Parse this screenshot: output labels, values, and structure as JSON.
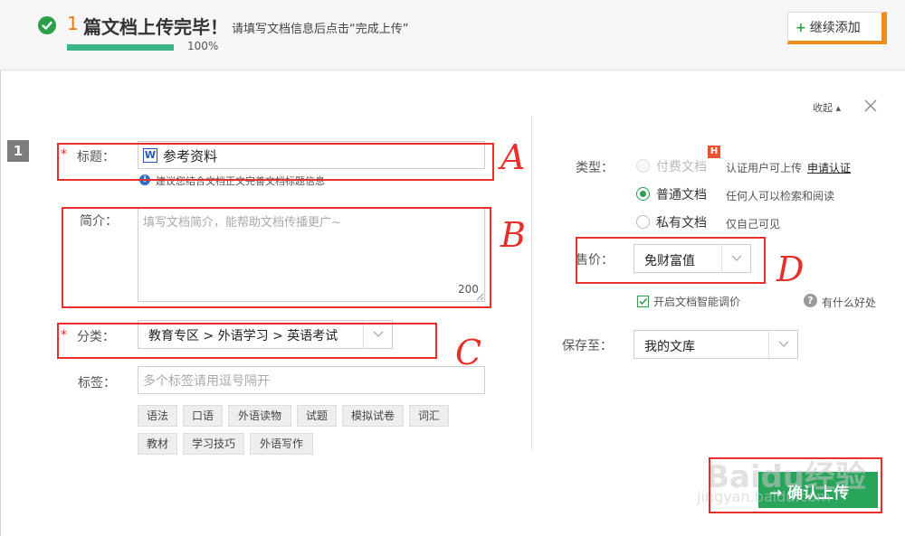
{
  "header": {
    "count": "1",
    "title": "篇文档上传完毕！",
    "hint": "请填写文档信息后点击“完成上传”",
    "progress_percent": 100,
    "progress_text": "100%",
    "continue_button": "继续添加"
  },
  "panel": {
    "collapse": "收起",
    "row_number": "1"
  },
  "form": {
    "title_label": "标题：",
    "title_value": "参考资料",
    "word_icon": "W",
    "title_tip": "建议您结合文档正文完善文档标题信息",
    "intro_label": "简介：",
    "intro_placeholder": "填写文档简介，能帮助文档传播更广~",
    "intro_count": "200",
    "category_label": "分类：",
    "category_value": "教育专区 > 外语学习 > 英语考试",
    "tags_label": "标签：",
    "tags_placeholder": "多个标签请用逗号隔开",
    "tags": [
      "语法",
      "口语",
      "外语读物",
      "试题",
      "模拟试卷",
      "词汇",
      "教材",
      "学习技巧",
      "外语写作"
    ],
    "required_mark": "*"
  },
  "settings": {
    "type_label": "类型：",
    "type_options": [
      {
        "label": "付费文档",
        "desc": "认证用户可上传",
        "link": "申请认证",
        "state": "disabled"
      },
      {
        "label": "普通文档",
        "desc": "任何人可以检索和阅读",
        "state": "checked"
      },
      {
        "label": "私有文档",
        "desc": "仅自己可见",
        "state": "unchecked"
      }
    ],
    "hot_badge": "H",
    "price_label": "售价：",
    "price_value": "免财富值",
    "smart_price_label": "开启文档智能调价",
    "smart_price_checked": true,
    "benefit_link": "有什么好处",
    "question_icon": "?",
    "save_label": "保存至：",
    "save_value": "我的文库"
  },
  "confirm_button": "确认上传",
  "annotations": [
    "A",
    "B",
    "C",
    "D"
  ],
  "watermark": {
    "main": "Baidu经验",
    "sub": "jingyan.baidu.com"
  },
  "colors": {
    "accent_green": "#29a55b",
    "accent_orange": "#f08b1d",
    "annotation_red": "#e8302a"
  }
}
